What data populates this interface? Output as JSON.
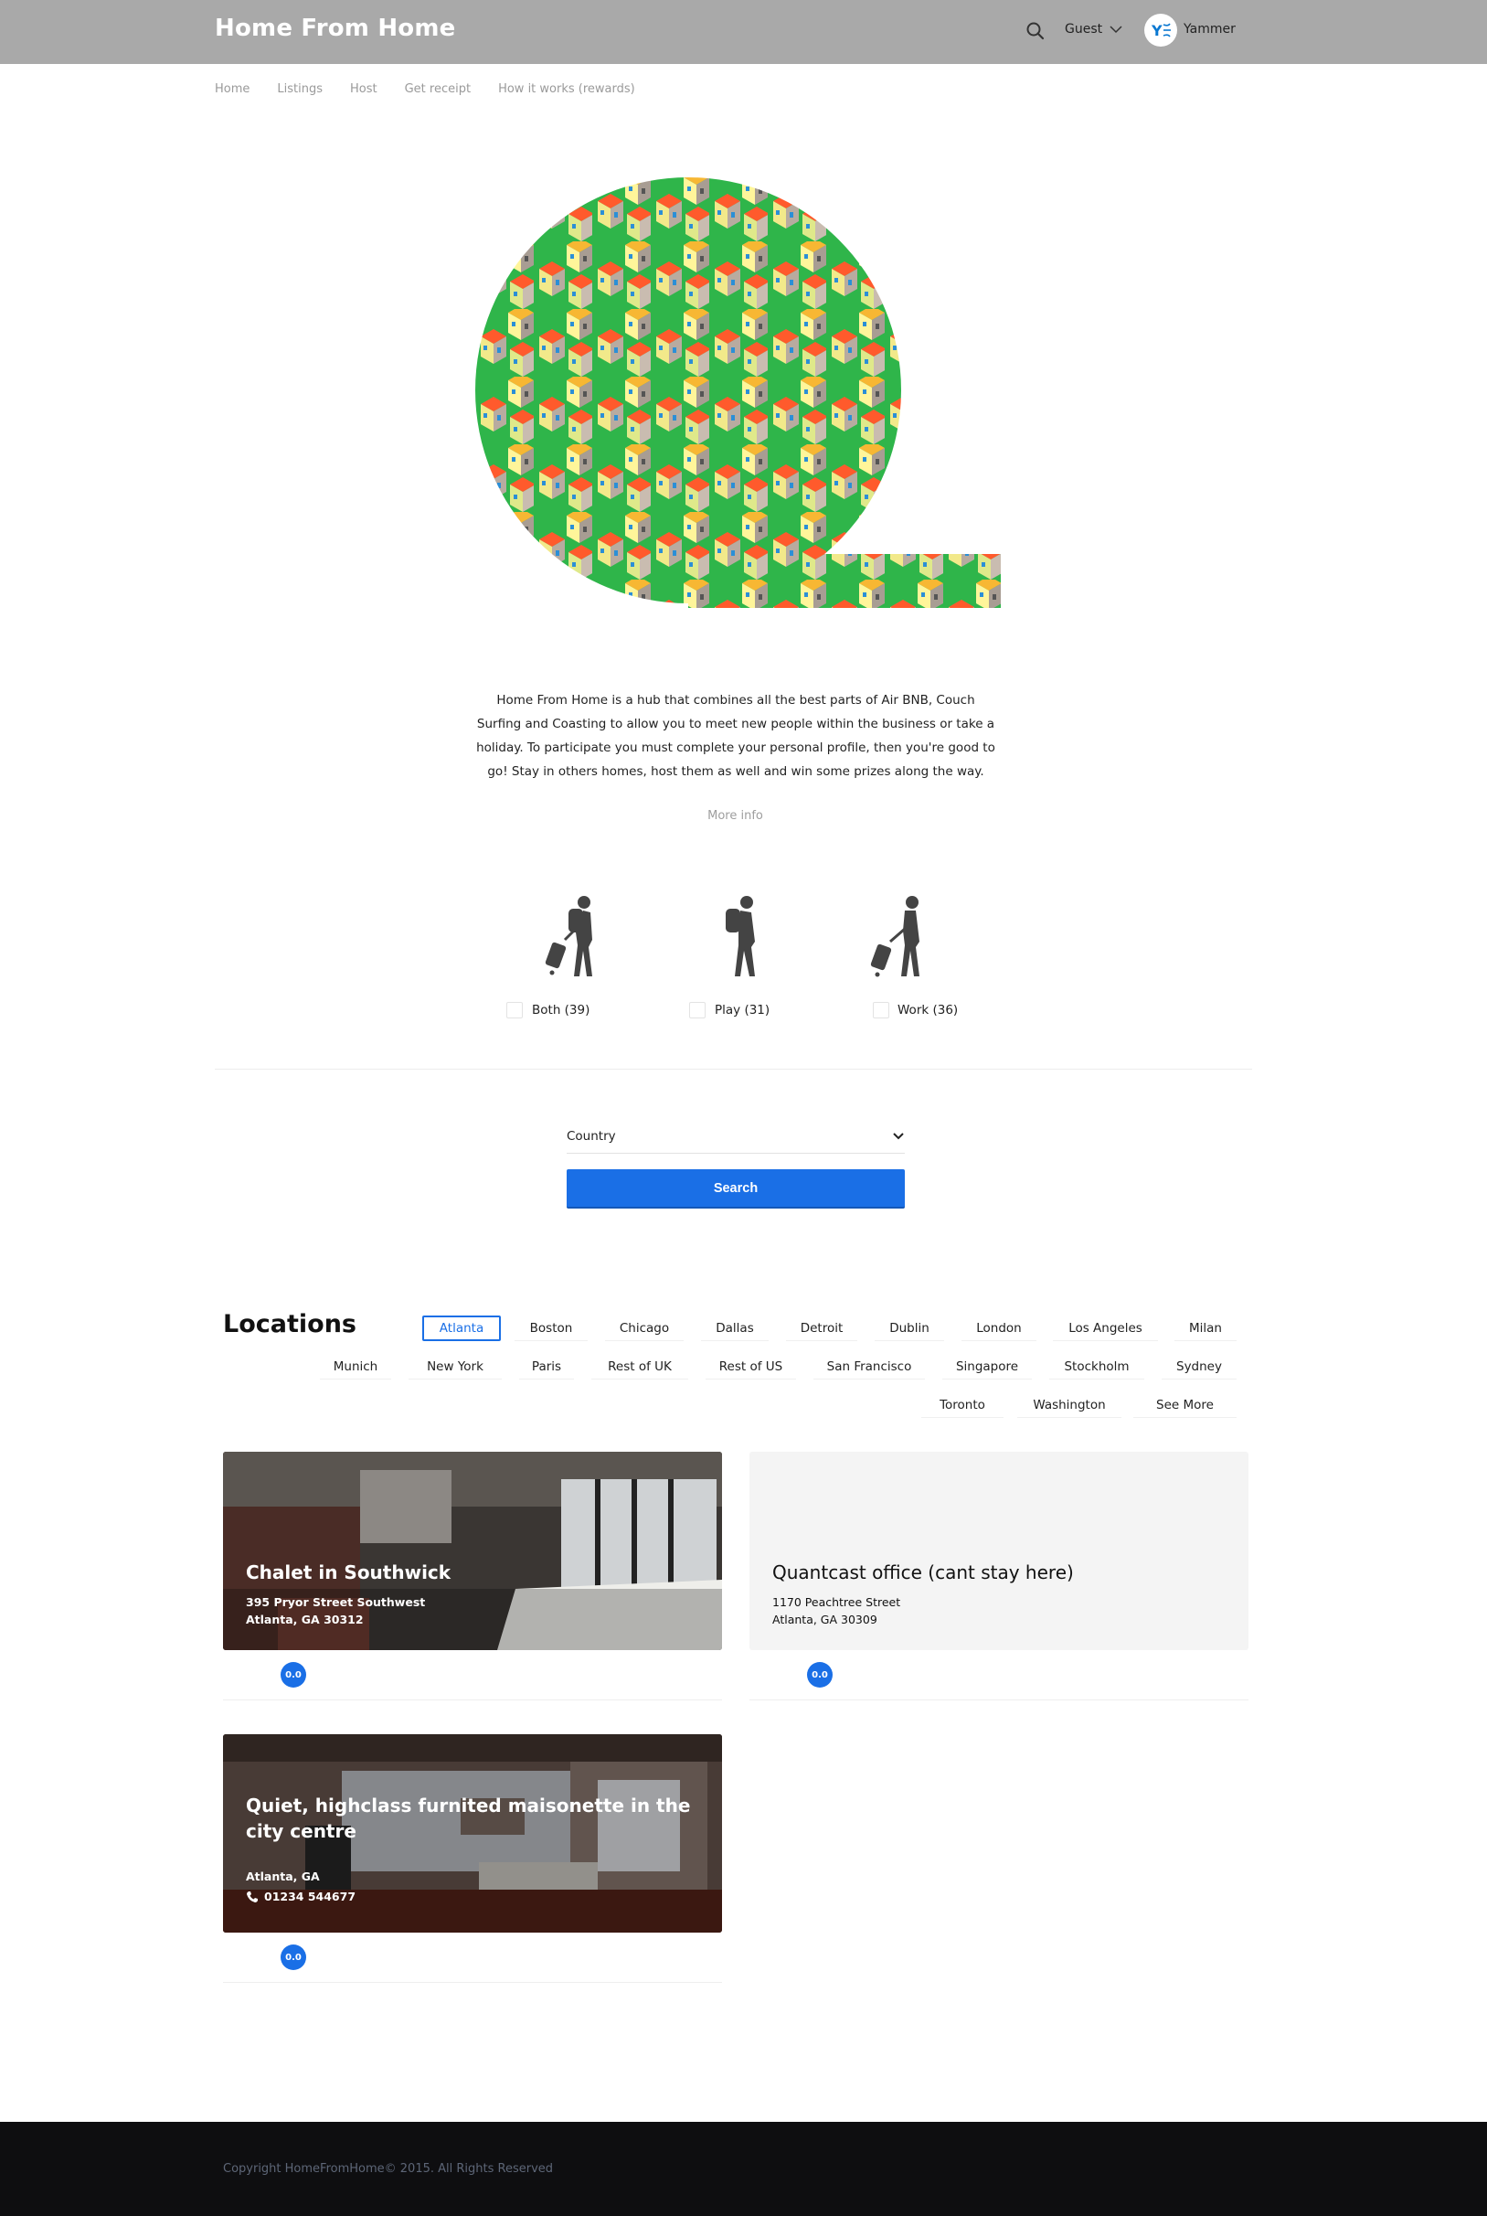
{
  "header": {
    "brand": "Home From Home",
    "guest_label": "Guest",
    "user_initials": "Y",
    "user_name": "Yammer"
  },
  "nav": {
    "items": [
      "Home",
      "Listings",
      "Host",
      "Get receipt",
      "How it works (rewards)"
    ]
  },
  "intro": {
    "text": "Home From Home is a hub that combines all the best parts of Air BNB, Couch Surfing and Coasting to allow you to meet new people within the business or take a holiday. To participate you must complete your personal profile, then you're good to go! Stay in others homes, host them as well and win some prizes along the way.",
    "more_info": "More info"
  },
  "travel_types": [
    {
      "label": "Both (39)",
      "icon": "traveler-suitcase-backpack-icon"
    },
    {
      "label": "Play (31)",
      "icon": "traveler-backpack-icon"
    },
    {
      "label": "Work (36)",
      "icon": "traveler-suitcase-icon"
    }
  ],
  "search": {
    "country_placeholder": "Country",
    "button_label": "Search"
  },
  "locations": {
    "title": "Locations",
    "active": "Atlanta",
    "items": [
      "Atlanta",
      "Boston",
      "Chicago",
      "Dallas",
      "Detroit",
      "Dublin",
      "London",
      "Los Angeles",
      "Milan",
      "Munich",
      "New York",
      "Paris",
      "Rest of UK",
      "Rest of US",
      "San Francisco",
      "Singapore",
      "Stockholm",
      "Sydney",
      "Toronto",
      "Washington",
      "See More"
    ]
  },
  "listings": [
    {
      "title": "Chalet in Southwick",
      "address_line1": "395 Pryor Street Southwest",
      "address_line2": "Atlanta, GA 30312",
      "rating": "0.0",
      "image": "bedroom-photo"
    },
    {
      "title": "Quantcast office (cant stay here)",
      "address_line1": "1170 Peachtree Street",
      "address_line2": "Atlanta, GA 30309",
      "rating": "0.0",
      "image": ""
    },
    {
      "title": "Quiet, highclass furnited maisonette in the city centre",
      "address_line1": "Atlanta, GA",
      "phone": "01234 544677",
      "rating": "0.0",
      "image": "living-room-photo"
    }
  ],
  "colors": {
    "accent": "#1a6fe6",
    "header_bg": "#a9a9a9",
    "footer_bg": "#0e0e10"
  },
  "footer": {
    "copyright": "Copyright HomeFromHome© 2015. All Rights Reserved"
  }
}
